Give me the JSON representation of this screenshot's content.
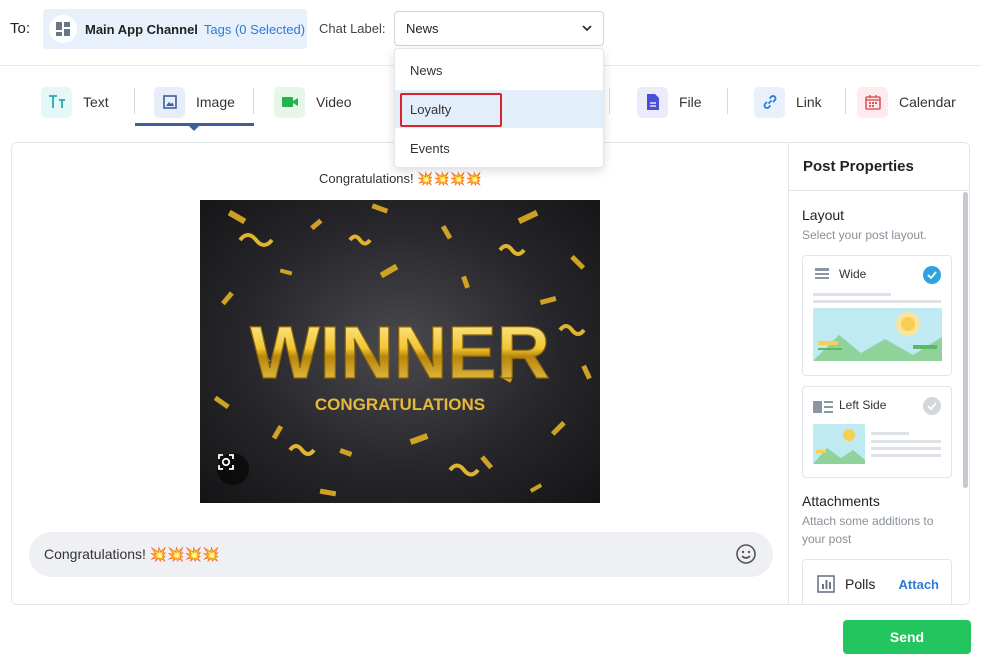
{
  "header": {
    "to_label": "To:",
    "channel_name": "Main App Channel",
    "tags_label": "Tags (0 Selected)",
    "chat_label": "Chat Label:",
    "selected_label": "News"
  },
  "dropdown": {
    "options": [
      "News",
      "Loyalty",
      "Events"
    ],
    "highlighted": "Loyalty"
  },
  "toolbar": {
    "tabs": [
      {
        "label": "Text",
        "icon": "text-icon",
        "color": "#e6f7f8"
      },
      {
        "label": "Image",
        "icon": "image-icon",
        "color": "#e8eef9",
        "active": true
      },
      {
        "label": "Video",
        "icon": "video-icon",
        "color": "#e6f7ea"
      },
      {
        "label": "File",
        "icon": "file-icon",
        "color": "#ebebfb"
      },
      {
        "label": "Link",
        "icon": "link-icon",
        "color": "#e8f0fb"
      },
      {
        "label": "Calendar",
        "icon": "calendar-icon",
        "color": "#fdeced"
      }
    ]
  },
  "post": {
    "caption": "Congratulations! 💥💥💥💥",
    "image_headline": "WINNER",
    "image_subline": "CONGRATULATIONS",
    "message": "Congratulations! 💥💥💥💥"
  },
  "properties": {
    "title": "Post Properties",
    "layout": {
      "title": "Layout",
      "subtitle": "Select your post layout.",
      "options": [
        {
          "label": "Wide",
          "selected": true
        },
        {
          "label": "Left Side",
          "selected": false
        }
      ]
    },
    "attachments": {
      "title": "Attachments",
      "subtitle": "Attach some additions to your post",
      "polls_label": "Polls",
      "attach_label": "Attach"
    }
  },
  "actions": {
    "send_label": "Send"
  },
  "colors": {
    "accent_blue": "#2f7ad6",
    "send_green": "#22c55e",
    "active_tab": "#3e5f99",
    "highlight_red": "#d9232d"
  }
}
